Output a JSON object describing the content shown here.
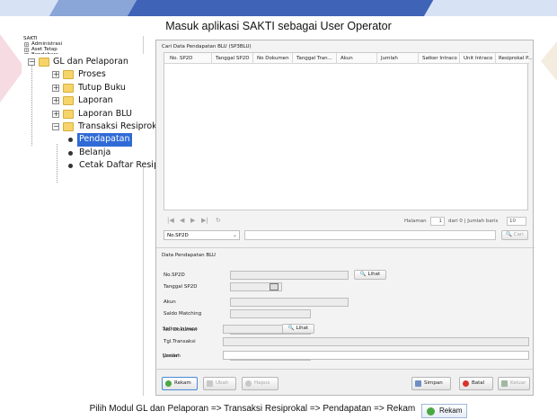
{
  "page_title": "Masuk aplikasi SAKTI sebagai User Operator",
  "caption": "Pilih Modul GL dan Pelaporan => Transaksi Resiprokal => Pendapatan => Rekam",
  "caption_button": "Rekam",
  "tree_small": [
    "SAKTI",
    "Administrasi",
    "Aset Tetap",
    "Bendahara"
  ],
  "tree": {
    "root": "GL dan Pelaporan",
    "children": [
      "Proses",
      "Tutup Buku",
      "Laporan",
      "Laporan BLU",
      "Transaksi Resiprokal"
    ],
    "leaves": [
      "Pendapatan",
      "Belanja",
      "Cetak Daftar Resiprokal"
    ]
  },
  "search_group": {
    "title": "Cari Data Pendapatan BLU (SP3BLU)",
    "columns": [
      "No. SP2D",
      "Tanggal SP2D",
      "No Dokumen",
      "Tanggal Tran...",
      "Akun",
      "Jumlah",
      "Satker Intraco",
      "Unit Intraco",
      "Resiprokal P..."
    ],
    "pager_halaman": "Halaman",
    "pager_page": "1",
    "pager_info": "dari 0  | Jumlah baris",
    "pager_rows": "10",
    "search_field": "No.SP2D",
    "search_button": "Cari"
  },
  "form": {
    "title": "Data Pendapatan BLU",
    "no_sp2d": "No.SP2D",
    "tanggal_sp2d": "Tanggal SP2D",
    "akun": "Akun",
    "saldo_matching": "Saldo Matching",
    "no_dokumen": "No. Dokumen",
    "tgl_transaksi": "Tgl.Transaksi",
    "jumlah": "Jumlah",
    "satker_intraco": "Satker Intraco",
    "uraian": "Uraian",
    "lihat": "Lihat"
  },
  "buttons": {
    "rekam": "Rekam",
    "ubah": "Ubah",
    "hapus": "Hapus",
    "simpan": "Simpan",
    "batal": "Batal",
    "keluar": "Keluar"
  },
  "colors": {
    "selection": "#2f6bd6",
    "rekam_icon": "#4aa844",
    "batal_icon": "#d9342b"
  }
}
